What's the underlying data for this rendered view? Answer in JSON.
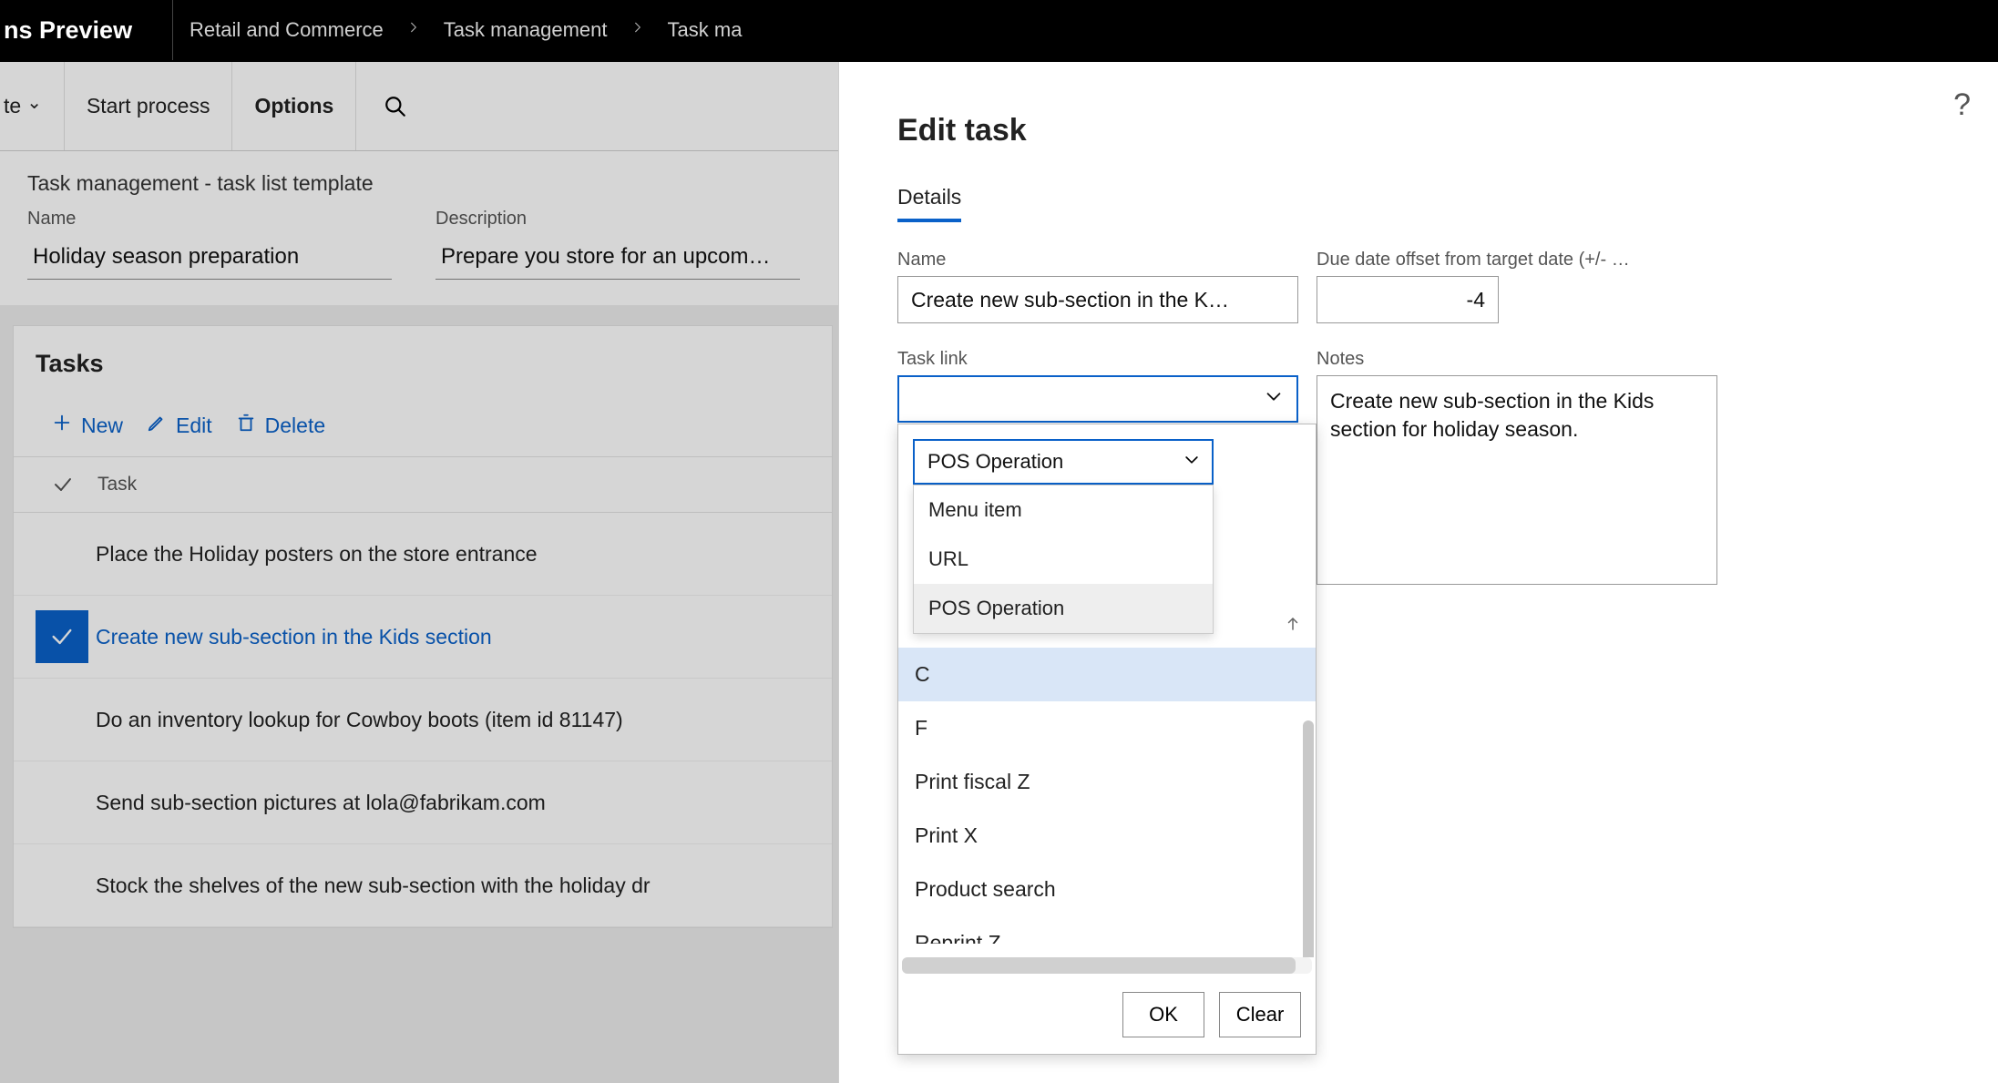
{
  "topbar": {
    "title_fragment": "ns Preview"
  },
  "breadcrumb": {
    "items": [
      "Retail and Commerce",
      "Task management",
      "Task ma"
    ]
  },
  "actionbar": {
    "item0_fragment": "te",
    "start_process": "Start process",
    "options": "Options"
  },
  "header": {
    "page_title": "Task management - task list template",
    "name_label": "Name",
    "name_value": "Holiday season preparation",
    "desc_label": "Description",
    "desc_value": "Prepare you store for an upcom…"
  },
  "tasks": {
    "title": "Tasks",
    "toolbar": {
      "new": "New",
      "edit": "Edit",
      "delete": "Delete"
    },
    "column_header": "Task",
    "rows": [
      {
        "text": "Place the Holiday posters on the store entrance",
        "selected": false
      },
      {
        "text": "Create new sub-section in the Kids section",
        "selected": true
      },
      {
        "text": "Do an inventory lookup for Cowboy boots (item id 81147)",
        "selected": false
      },
      {
        "text": "Send sub-section pictures at lola@fabrikam.com",
        "selected": false
      },
      {
        "text": "Stock the shelves of the new sub-section with the holiday dr",
        "selected": false
      }
    ]
  },
  "panel": {
    "title": "Edit task",
    "tab": "Details",
    "name_label": "Name",
    "name_value": "Create new sub-section in the K…",
    "due_label": "Due date offset from target date (+/- …",
    "due_value": "-4",
    "tasklink_label": "Task link",
    "tasklink_value": "",
    "notes_label": "Notes",
    "notes_value": "Create new sub-section in the Kids section for holiday season."
  },
  "tasklink_dropdown": {
    "type_select_value": "POS Operation",
    "type_options": [
      "Menu item",
      "URL",
      "POS Operation"
    ],
    "type_highlight_index": 2,
    "search_prefix": "C",
    "list": [
      {
        "label": "C",
        "selected": true,
        "truncated": true
      },
      {
        "label": "F",
        "selected": false,
        "truncated": true
      },
      {
        "label": "Print fiscal Z",
        "selected": false
      },
      {
        "label": "Print X",
        "selected": false
      },
      {
        "label": "Product search",
        "selected": false
      },
      {
        "label": "Reprint Z",
        "selected": false,
        "cut": true
      }
    ],
    "footer": {
      "ok": "OK",
      "clear": "Clear"
    }
  }
}
